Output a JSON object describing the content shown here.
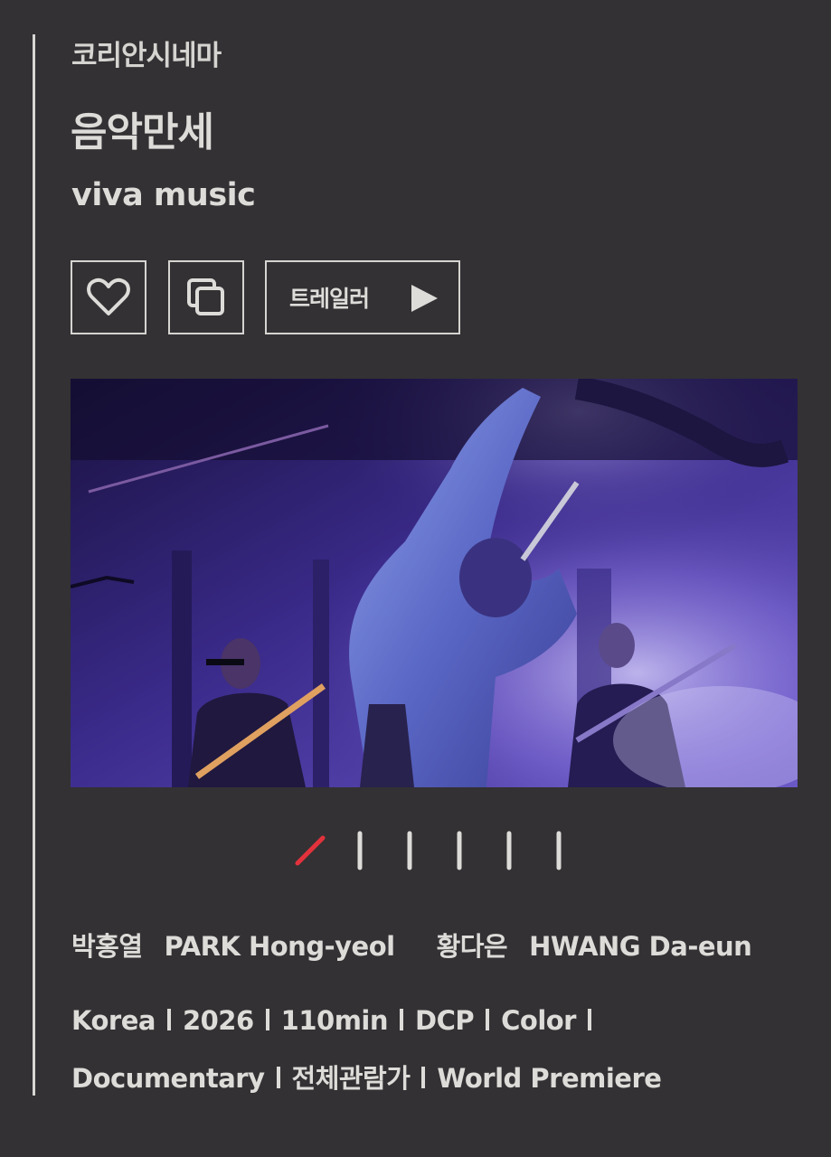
{
  "section_label": "코리안시네마",
  "film": {
    "title_ko": "음악만세",
    "title_en": "viva music"
  },
  "actions": {
    "trailer_label": "트레일러",
    "like_icon": "heart-icon",
    "copy_icon": "copy-icon",
    "play_icon": "play-icon"
  },
  "carousel": {
    "total_slides": 6,
    "active_index": 0,
    "active_color": "#e2323c"
  },
  "directors": [
    {
      "name_ko": "박홍열",
      "name_en": "PARK Hong-yeol"
    },
    {
      "name_ko": "황다은",
      "name_en": "HWANG Da-eun"
    }
  ],
  "specs": {
    "country": "Korea",
    "year": "2026",
    "runtime": "110min",
    "format": "DCP",
    "color": "Color",
    "genre": "Documentary",
    "rating": "전체관람가",
    "premiere": "World Premiere"
  }
}
